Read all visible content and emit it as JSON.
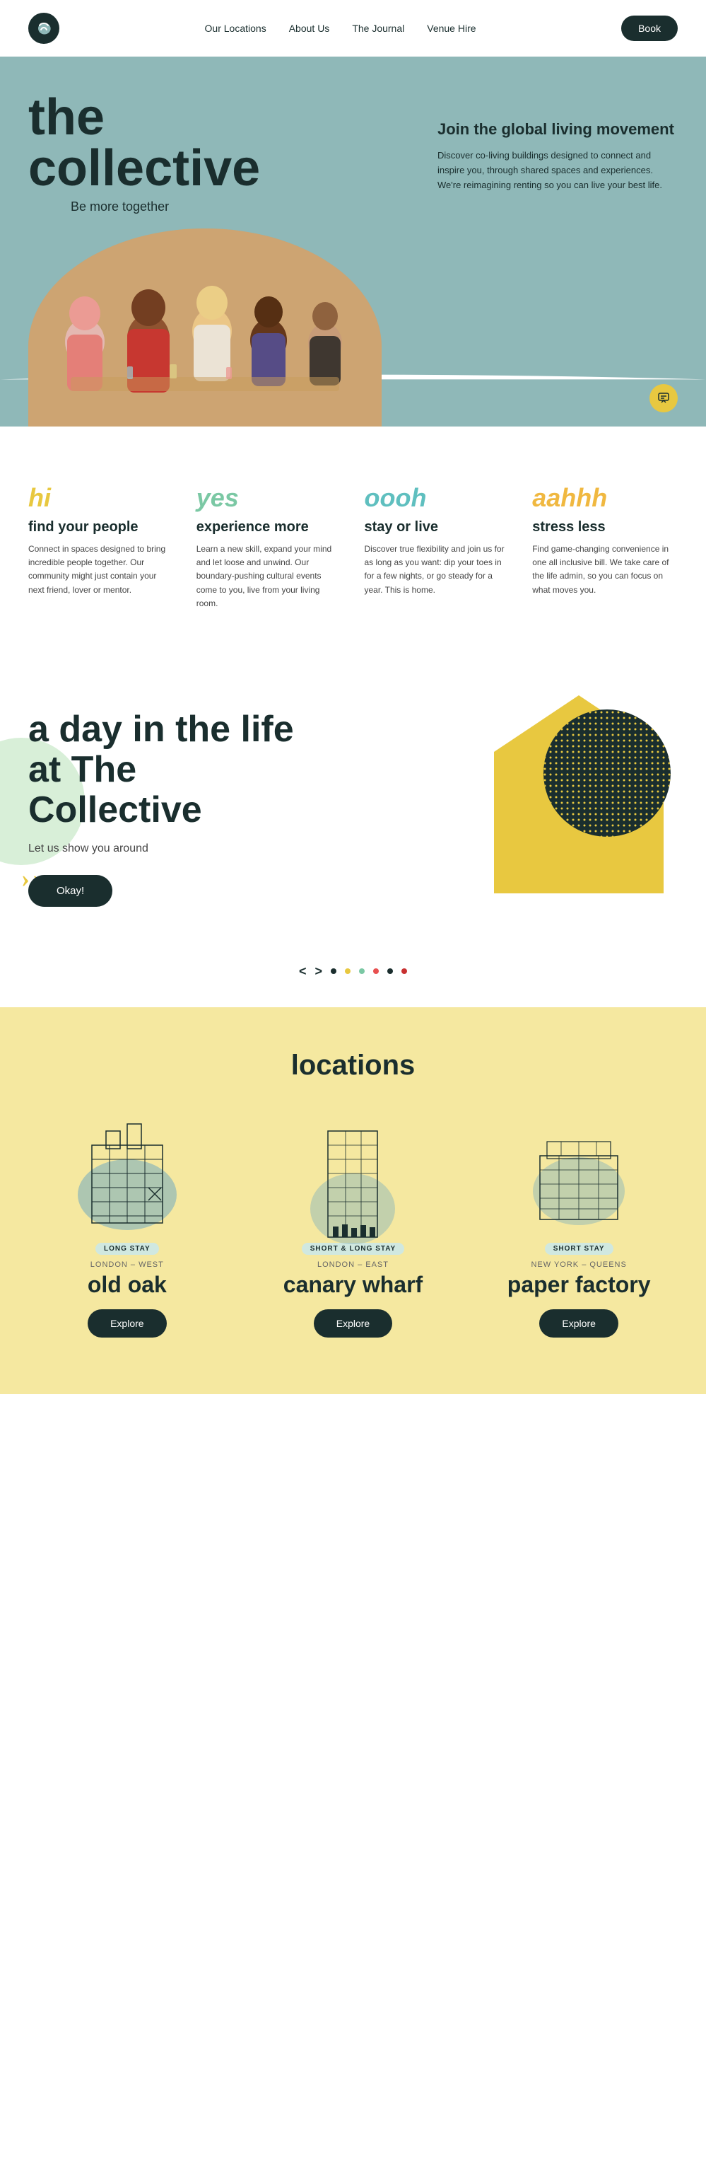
{
  "nav": {
    "logo_alt": "The Collective Logo",
    "links": [
      {
        "label": "Our Locations",
        "href": "#"
      },
      {
        "label": "About Us",
        "href": "#"
      },
      {
        "label": "The Journal",
        "href": "#"
      },
      {
        "label": "Venue Hire",
        "href": "#"
      }
    ],
    "book_label": "Book"
  },
  "hero": {
    "title_line1": "the",
    "title_line2": "collective",
    "subtitle": "Be more together",
    "tagline": "Join the global living movement",
    "description": "Discover co-living buildings designed to connect and inspire you, through shared spaces and experiences. We're reimagining renting so you can live your best life."
  },
  "features": [
    {
      "word": "hi",
      "word_class": "yellow",
      "title": "find your people",
      "desc": "Connect in spaces designed to bring incredible people together. Our community might just contain your next friend, lover or mentor."
    },
    {
      "word": "yes",
      "word_class": "green",
      "title": "experience more",
      "desc": "Learn a new skill, expand your mind and let loose and unwind. Our boundary-pushing cultural events come to you, live from your living room."
    },
    {
      "word": "oooh",
      "word_class": "teal",
      "title": "stay or live",
      "desc": "Discover true flexibility and join us for as long as you want: dip your toes in for a few nights, or go steady for a year. This is home."
    },
    {
      "word": "aahhh",
      "word_class": "amber",
      "title": "stress less",
      "desc": "Find game-changing convenience in one all inclusive bill. We take care of the life admin, so you can focus on what moves you."
    }
  ],
  "day_section": {
    "title_line1": "a day in the life",
    "title_line2": "at The Collective",
    "subtitle": "Let us show you around",
    "cta_label": "Okay!"
  },
  "carousel": {
    "prev_label": "<",
    "next_label": ">",
    "dots": [
      {
        "color": "dark"
      },
      {
        "color": "yellow"
      },
      {
        "color": "green"
      },
      {
        "color": "red"
      },
      {
        "color": "dark"
      },
      {
        "color": "darkred"
      }
    ]
  },
  "locations": {
    "title": "locations",
    "items": [
      {
        "tag": "LONG STAY",
        "region": "LONDON – WEST",
        "name": "old oak",
        "btn_label": "Explore"
      },
      {
        "tag": "SHORT & LONG STAY",
        "region": "LONDON – EAST",
        "name": "canary wharf",
        "btn_label": "Explore"
      },
      {
        "tag": "SHORT STAY",
        "region": "NEW YORK – QUEENS",
        "name": "paper factory",
        "btn_label": "Explore"
      }
    ]
  }
}
